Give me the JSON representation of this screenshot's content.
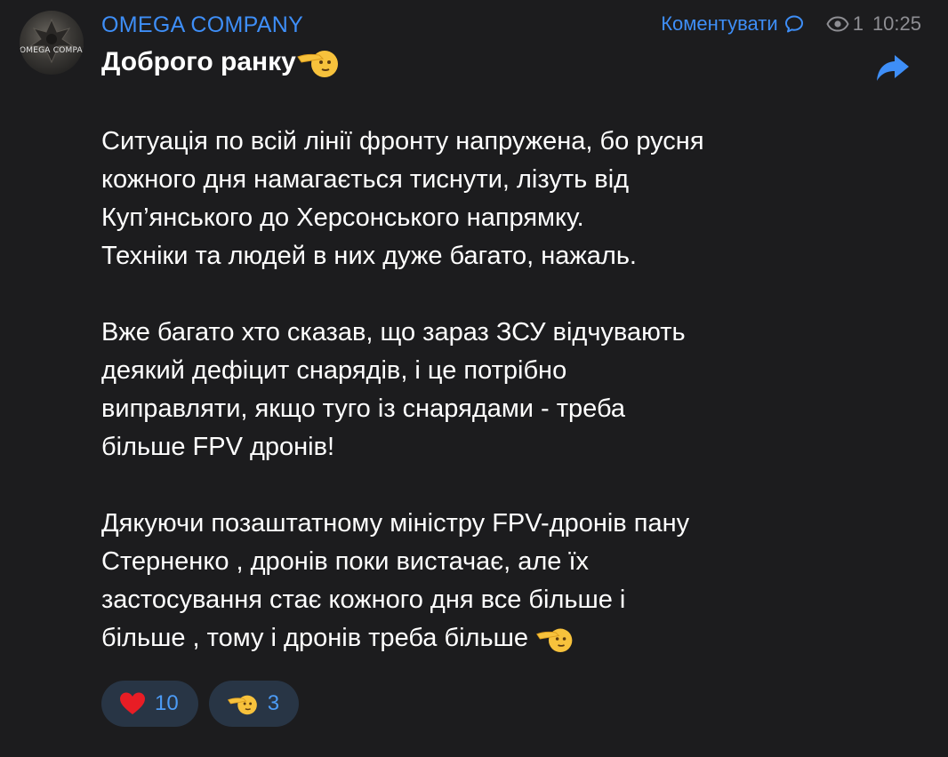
{
  "channel": {
    "name": "OMEGA COMPANY",
    "avatar_text": "OMEGA COMPANY"
  },
  "meta": {
    "comment_label": "Коментувати",
    "views": "1",
    "time": "10:25"
  },
  "post": {
    "title": "Доброго ранку",
    "paragraphs": [
      [
        "Ситуація по всій лінії фронту напружена, бо русня",
        "кожного дня намагається тиснути, лізуть від",
        "Куп’янського до Херсонського напрямку.",
        "Техніки та людей в них дуже багато, нажаль."
      ],
      [
        "Вже багато хто сказав, що зараз ЗСУ відчувають",
        "деякий дефіцит снарядів, і це потрібно",
        "виправляти, якщо туго із снарядами - треба",
        "більше FPV дронів!"
      ],
      [
        "Дякуючи позаштатному  міністру FPV-дронів пану",
        "Стерненко , дронів поки вистачає, але їх",
        "застосування стає кожного дня  все більше і",
        "більше , тому і дронів треба більше"
      ]
    ]
  },
  "reactions": [
    {
      "icon": "heart-icon",
      "count": "10"
    },
    {
      "icon": "saluting-face-icon",
      "count": "3"
    }
  ],
  "colors": {
    "background": "#1c1c1e",
    "accent": "#3e8ef7",
    "muted": "#8e8e93",
    "reaction_bg": "#283545"
  }
}
